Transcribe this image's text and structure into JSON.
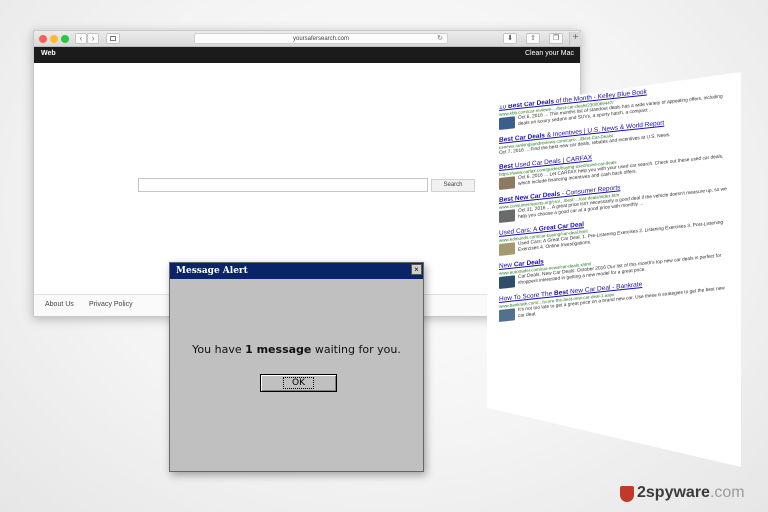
{
  "browser": {
    "url": "yoursafersearch.com",
    "brand": "Web",
    "promo": "Clean your Mac",
    "search_button": "Search",
    "nav": {
      "back": "‹",
      "forward": "›",
      "reload": "↻",
      "new_tab": "+"
    },
    "footer": {
      "about": "About Us",
      "privacy": "Privacy Policy"
    }
  },
  "dialog": {
    "title": "Message Alert",
    "close": "×",
    "message_prefix": "You have ",
    "message_bold": "1 message",
    "message_suffix": " waiting for you.",
    "ok": "OK"
  },
  "results": [
    {
      "title_prefix": "10 ",
      "title_bold": "Best Car Deals",
      "title_suffix": " of the Month - Kelley Blue Book",
      "url": "www.kbb.com/car-reviews-.../best-car-deals/2300069447/",
      "snippet": "Oct 6, 2016 ... This months list of standout deals has a wide variety of appealing offers, including deals on luxury sedans and SUVs, a sporty hatch, a compact ...",
      "thumb": "#3b5f8a"
    },
    {
      "title_prefix": "",
      "title_bold": "Best Car Deals",
      "title_suffix": " & Incentives | U.S. News & World Report",
      "url": "usnews.rankingsandreviews.com/cars-.../Best-Car-Deals/",
      "snippet": "Oct 7, 2016 ... Find the best new car deals, rebates and incentives at U.S. News.",
      "thumb": ""
    },
    {
      "title_prefix": "",
      "title_bold": "Best",
      "title_suffix": " Used Car Deals | CARFAX",
      "url": "https://www.carfax.com/guides/buying-used/used-car-deals",
      "snippet": "Oct 6, 2016 ... Let CARFAX help you with your used car search. Check out these used car deals, which include financing incentives and cash back offers.",
      "thumb": "#8c7a63"
    },
    {
      "title_prefix": "",
      "title_bold": "Best New Car Deals",
      "title_suffix": " - Consumer Reports",
      "url": "www.consumerreports.org/cro/.../best-.../car-deals/index.htm",
      "snippet": "Oct 31, 2016 ... A great price isn't necessarily a good deal if the vehicle doesn't measure up, so we help you choose a good car at a good price with monthly ...",
      "thumb": "#6a6a6a"
    },
    {
      "title_prefix": "Used Cars: A ",
      "title_bold": "Great Car Deal",
      "title_suffix": "",
      "url": "www.edmunds.com/car-buying/car-deal.html",
      "snippet": "Used Cars: A Great Car Deal. 1. Pre-Listening Exercises 2. Listening Exercises 3. Post-Listening Exercises 4. Online Investigations.",
      "thumb": "#a39a6e"
    },
    {
      "title_prefix": "New ",
      "title_bold": "Car Deals",
      "title_suffix": "",
      "url": "www.autotrader.com/car-news/car-deals.xhtml",
      "snippet": "Car Deals. New Car Deals: October 2016 Our list of this month's top new car deals is perfect for shoppers interested in getting a new model for a great price.",
      "thumb": "#2e4d6b"
    },
    {
      "title_prefix": "How To Score The ",
      "title_bold": "Best",
      "title_suffix": " New Car Deal - Bankrate",
      "url": "www.bankrate.com/.../score-the-best-new-car-deal-1.aspx",
      "snippet": "It's not too late to get a great price on a brand new car. Use these 6 strategies to get the best new car deal.",
      "thumb": "#54708f"
    }
  ],
  "watermark": {
    "brand": "2spyware",
    "suffix": ".com"
  }
}
